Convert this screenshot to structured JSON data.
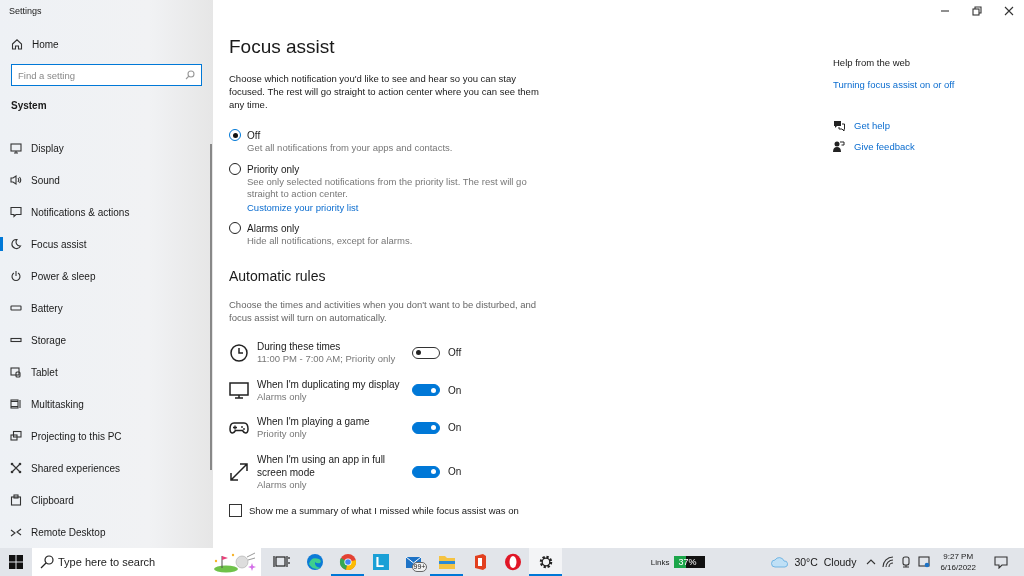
{
  "window": {
    "title": "Settings"
  },
  "sidebar": {
    "home": "Home",
    "search": {
      "placeholder": "Find a setting"
    },
    "section": "System",
    "items": [
      {
        "label": "Display",
        "selected": false
      },
      {
        "label": "Sound",
        "selected": false
      },
      {
        "label": "Notifications & actions",
        "selected": false
      },
      {
        "label": "Focus assist",
        "selected": true
      },
      {
        "label": "Power & sleep",
        "selected": false
      },
      {
        "label": "Battery",
        "selected": false
      },
      {
        "label": "Storage",
        "selected": false
      },
      {
        "label": "Tablet",
        "selected": false
      },
      {
        "label": "Multitasking",
        "selected": false
      },
      {
        "label": "Projecting to this PC",
        "selected": false
      },
      {
        "label": "Shared experiences",
        "selected": false
      },
      {
        "label": "Clipboard",
        "selected": false
      },
      {
        "label": "Remote Desktop",
        "selected": false
      }
    ]
  },
  "main": {
    "title": "Focus assist",
    "intro": "Choose which notification you'd like to see and hear so you can stay focused. The rest will go straight to action center where you can see them any time.",
    "options": [
      {
        "label": "Off",
        "description": "Get all notifications from your apps and contacts.",
        "selected": true
      },
      {
        "label": "Priority only",
        "description": "See only selected notifications from the priority list. The rest will go straight to action center.",
        "link": "Customize your priority list",
        "selected": false
      },
      {
        "label": "Alarms only",
        "description": "Hide all notifications, except for alarms.",
        "selected": false
      }
    ],
    "rules_heading": "Automatic rules",
    "rules_intro": "Choose the times and activities when you don't want to be disturbed, and focus assist will turn on automatically.",
    "rules": [
      {
        "title": "During these times",
        "detail": "11:00 PM - 7:00 AM; Priority only",
        "on": false,
        "state": "Off"
      },
      {
        "title": "When I'm duplicating my display",
        "detail": "Alarms only",
        "on": true,
        "state": "On"
      },
      {
        "title": "When I'm playing a game",
        "detail": "Priority only",
        "on": true,
        "state": "On"
      },
      {
        "title": "When I'm using an app in full screen mode",
        "detail": "Alarms only",
        "on": true,
        "state": "On"
      }
    ],
    "summary": {
      "label": "Show me a summary of what I missed while focus assist was on",
      "checked": false
    }
  },
  "help": {
    "heading": "Help from the web",
    "link": "Turning focus assist on or off",
    "actions": [
      "Get help",
      "Give feedback"
    ]
  },
  "taskbar": {
    "search": {
      "placeholder": "Type here to search"
    },
    "apps": [
      {
        "running": false,
        "selected": false
      },
      {
        "running": false,
        "selected": false
      },
      {
        "running": true,
        "selected": false
      },
      {
        "label": "L",
        "running": false,
        "selected": false
      },
      {
        "badge": "99+",
        "running": false,
        "selected": false
      },
      {
        "running": true,
        "selected": false
      },
      {
        "running": false,
        "selected": false
      },
      {
        "running": false,
        "selected": false
      },
      {
        "running": true,
        "selected": true
      }
    ],
    "links": "Links",
    "battery": {
      "reading": "37%",
      "level": 0.37
    },
    "weather": "30°C  Cloudy",
    "time": "9:27 PM",
    "date": "6/16/2022"
  }
}
